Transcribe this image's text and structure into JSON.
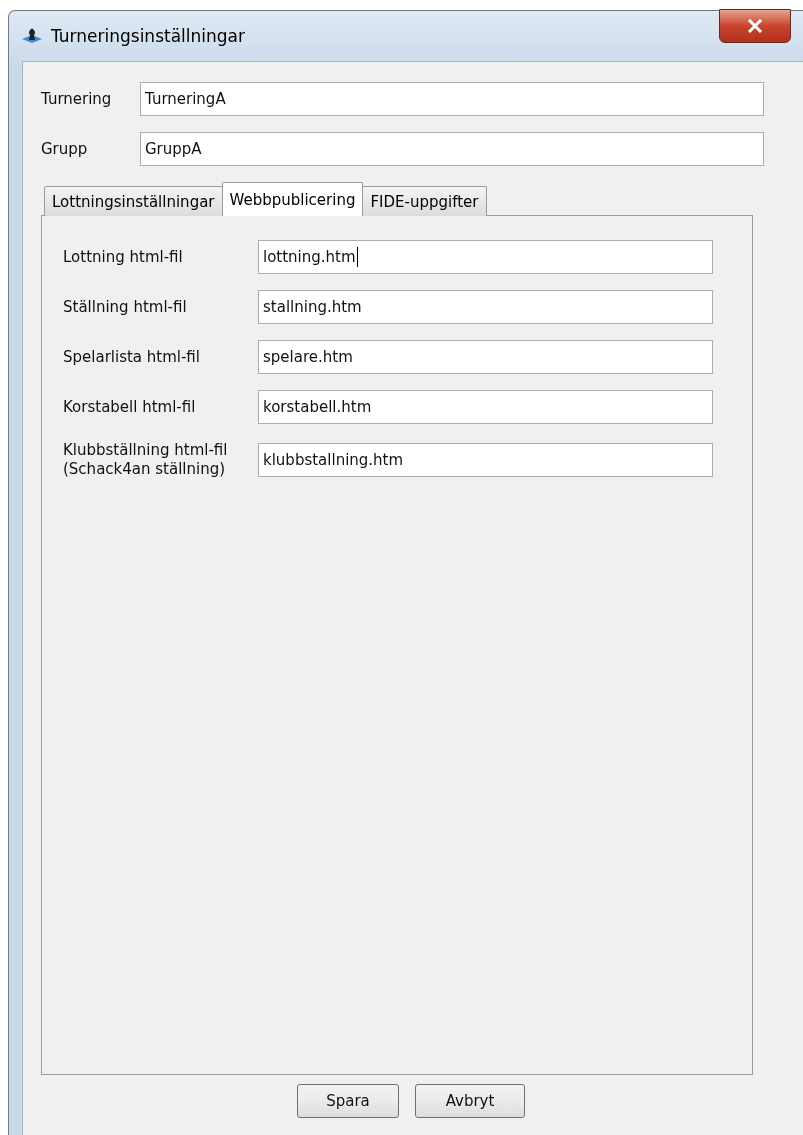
{
  "window": {
    "title": "Turneringsinställningar"
  },
  "fields": [
    {
      "label": "Turnering",
      "value": "TurneringA"
    },
    {
      "label": "Grupp",
      "value": "GruppA"
    }
  ],
  "tabs": [
    {
      "label": "Lottningsinställningar",
      "selected": false
    },
    {
      "label": "Webbpublicering",
      "selected": true
    },
    {
      "label": "FIDE-uppgifter",
      "selected": false
    }
  ],
  "file_fields": [
    {
      "label": "Lottning html-fil",
      "value": "lottning.htm",
      "focused": true
    },
    {
      "label": "Ställning html-fil",
      "value": "stallning.htm",
      "focused": false
    },
    {
      "label": "Spelarlista html-fil",
      "value": "spelare.htm",
      "focused": false
    },
    {
      "label": "Korstabell html-fil",
      "value": "korstabell.htm",
      "focused": false
    },
    {
      "label": "Klubbställning html-fil\n(Schack4an ställning)",
      "value": "klubbstallning.htm",
      "focused": false
    }
  ],
  "buttons": [
    "Spara",
    "Avbryt"
  ]
}
